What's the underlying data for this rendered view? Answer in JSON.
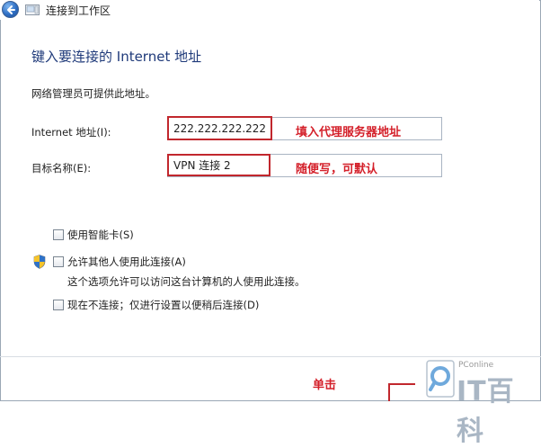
{
  "window": {
    "title": "连接到工作区"
  },
  "page": {
    "heading": "键入要连接的 Internet 地址",
    "description": "网络管理员可提供此地址。"
  },
  "fields": {
    "internet_address": {
      "label": "Internet 地址(I):",
      "value": "222.222.222.222"
    },
    "destination_name": {
      "label": "目标名称(E):",
      "value": "VPN 连接 2"
    }
  },
  "annotations": {
    "address_note": "填入代理服务器地址",
    "name_note": "随便写，可默认",
    "click_note": "单击"
  },
  "options": {
    "smart_card": "使用智能卡(S)",
    "allow_others": "允许其他人使用此连接(A)",
    "allow_others_note": "这个选项允许可以访问这台计算机的人使用此连接。",
    "connect_later": "现在不连接；仅进行设置以便稍后连接(D)"
  },
  "watermark": {
    "small": "PConline",
    "brand": "IT百科"
  },
  "colors": {
    "accent_red": "#d4202a",
    "heading_blue": "#1f3a7a"
  },
  "icons": [
    "back-arrow-icon",
    "network-folder-icon",
    "uac-shield-icon"
  ]
}
